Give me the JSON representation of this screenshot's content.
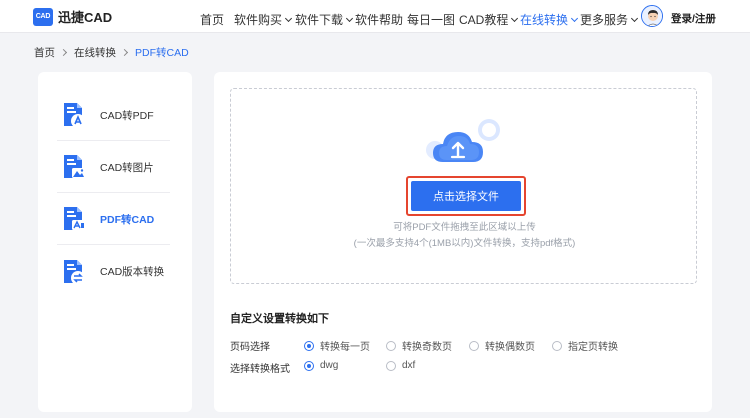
{
  "header": {
    "logo_mark": "CAD",
    "logo_text": "迅捷CAD",
    "nav": [
      {
        "label": "首页",
        "dropdown": false,
        "active": false
      },
      {
        "label": "软件购买",
        "dropdown": true,
        "active": false
      },
      {
        "label": "软件下载",
        "dropdown": true,
        "active": false
      },
      {
        "label": "软件帮助",
        "dropdown": false,
        "active": false
      },
      {
        "label": "每日一图",
        "dropdown": false,
        "active": false
      },
      {
        "label": "CAD教程",
        "dropdown": true,
        "active": false
      },
      {
        "label": "在线转换",
        "dropdown": true,
        "active": true
      },
      {
        "label": "更多服务",
        "dropdown": true,
        "active": false
      }
    ],
    "login": "登录/注册"
  },
  "breadcrumb": [
    "首页",
    "在线转换",
    "PDF转CAD"
  ],
  "sidebar": {
    "items": [
      {
        "label": "CAD转PDF",
        "active": false,
        "icon": "cad-to-pdf-icon"
      },
      {
        "label": "CAD转图片",
        "active": false,
        "icon": "cad-to-image-icon"
      },
      {
        "label": "PDF转CAD",
        "active": true,
        "icon": "pdf-to-cad-icon"
      },
      {
        "label": "CAD版本转换",
        "active": false,
        "icon": "cad-version-icon"
      }
    ]
  },
  "upload": {
    "button": "点击选择文件",
    "hint1": "可将PDF文件拖拽至此区域以上传",
    "hint2": "(一次最多支持4个(1MB以内)文件转换，支持pdf格式)"
  },
  "settings": {
    "title": "自定义设置转换如下",
    "page_select": {
      "label": "页码选择",
      "options": [
        "转换每一页",
        "转换奇数页",
        "转换偶数页",
        "指定页转换"
      ],
      "selected": 0
    },
    "format_select": {
      "label": "选择转换格式",
      "options": [
        "dwg",
        "dxf"
      ],
      "selected": 0
    }
  },
  "colors": {
    "accent": "#2c6fef",
    "highlight": "#e5452f"
  }
}
